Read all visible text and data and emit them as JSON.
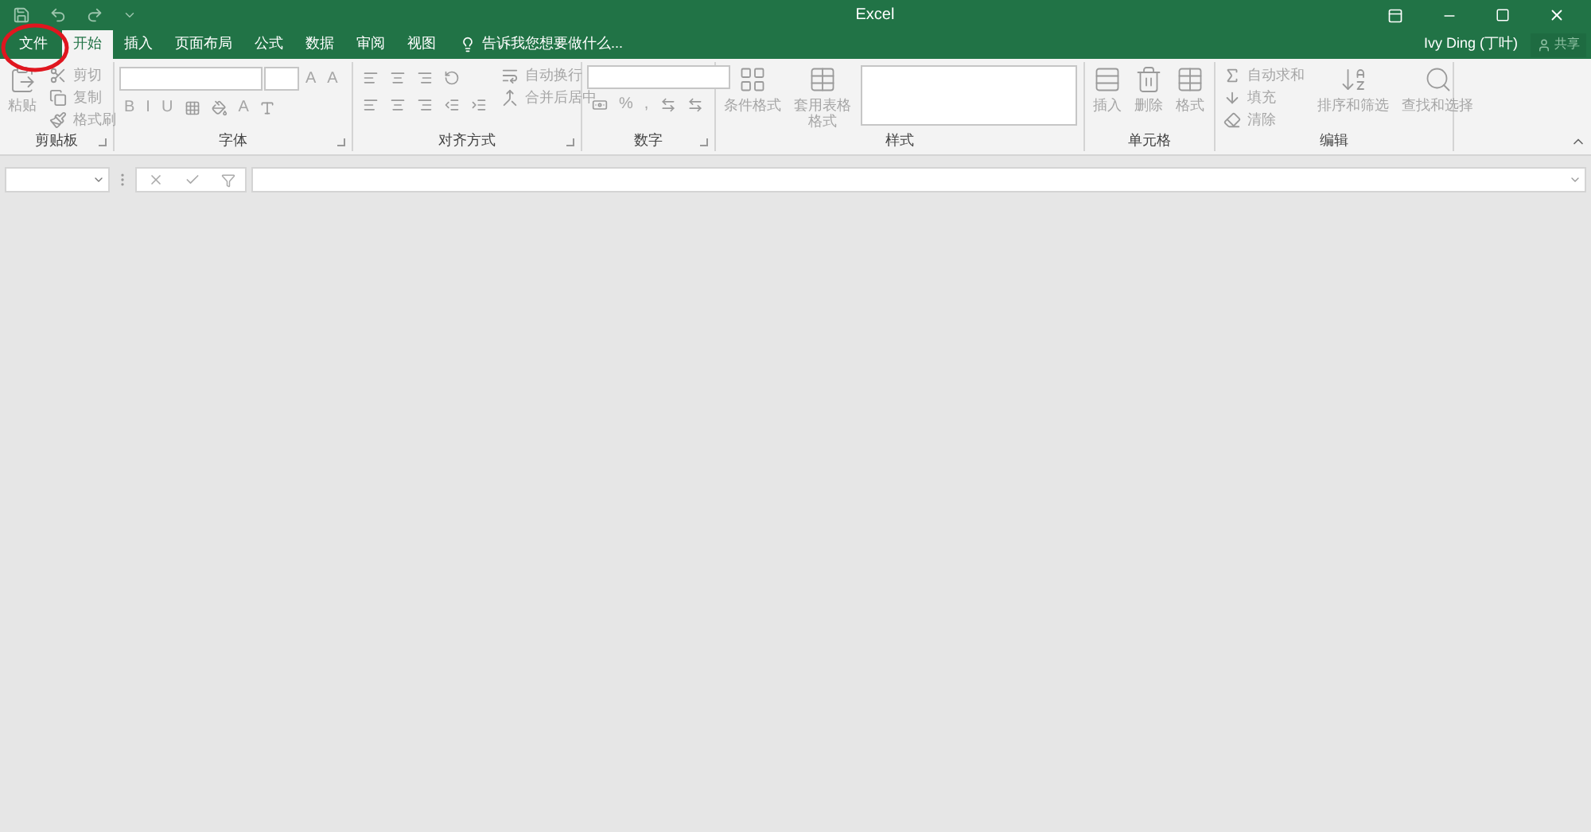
{
  "window": {
    "title": "Excel",
    "user": "Ivy Ding (丁叶)",
    "share": "共享"
  },
  "tabs": [
    {
      "label": "文件",
      "selected": false,
      "kind": "file"
    },
    {
      "label": "开始",
      "selected": true,
      "kind": "tab"
    },
    {
      "label": "插入",
      "selected": false,
      "kind": "tab"
    },
    {
      "label": "页面布局",
      "selected": false,
      "kind": "tab"
    },
    {
      "label": "公式",
      "selected": false,
      "kind": "tab"
    },
    {
      "label": "数据",
      "selected": false,
      "kind": "tab"
    },
    {
      "label": "审阅",
      "selected": false,
      "kind": "tab"
    },
    {
      "label": "视图",
      "selected": false,
      "kind": "tab"
    }
  ],
  "tell_me": "告诉我您想要做什么...",
  "ribbon": {
    "disabled": true,
    "groups": [
      {
        "label": "剪贴板",
        "launcher": true,
        "cols": [
          [
            [
              {
                "kind": "large",
                "label": "粘贴"
              }
            ]
          ],
          [
            [
              {
                "kind": "small",
                "label": "剪切"
              }
            ],
            [
              {
                "kind": "small",
                "label": "复制"
              }
            ],
            [
              {
                "kind": "small",
                "label": "格式刷"
              }
            ]
          ]
        ]
      },
      {
        "label": "字体",
        "launcher": true,
        "cols": [
          [
            [
              {
                "kind": "combo"
              },
              {
                "kind": "combo_small"
              },
              {
                "kind": "glyph",
                "label": "A"
              },
              {
                "kind": "glyph",
                "label": "A"
              }
            ],
            [
              {
                "kind": "glyph",
                "label": "B"
              },
              {
                "kind": "glyph",
                "label": "I"
              },
              {
                "kind": "glyph",
                "label": "U"
              },
              {
                "kind": "icon"
              },
              {
                "kind": "icon"
              },
              {
                "kind": "glyph",
                "label": "A"
              },
              {
                "kind": "icon"
              }
            ]
          ]
        ]
      },
      {
        "label": "对齐方式",
        "launcher": true,
        "cols": [
          [
            [
              {
                "kind": "icon"
              },
              {
                "kind": "icon"
              },
              {
                "kind": "icon"
              },
              {
                "kind": "icon"
              }
            ],
            [
              {
                "kind": "icon"
              },
              {
                "kind": "icon"
              },
              {
                "kind": "icon"
              },
              {
                "kind": "icon"
              },
              {
                "kind": "icon"
              }
            ]
          ],
          [
            [
              {
                "kind": "small",
                "label": "自动换行"
              }
            ],
            [
              {
                "kind": "small",
                "label": "合并后居中"
              }
            ]
          ]
        ]
      },
      {
        "label": "数字",
        "launcher": true,
        "cols": [
          [
            [
              {
                "kind": "combo"
              }
            ],
            [
              {
                "kind": "icon"
              },
              {
                "kind": "glyph",
                "label": "%"
              },
              {
                "kind": "glyph",
                "label": ","
              },
              {
                "kind": "icon"
              },
              {
                "kind": "icon"
              }
            ]
          ]
        ]
      },
      {
        "label": "样式",
        "launcher": false,
        "cols": [
          [
            [
              {
                "kind": "large",
                "label": "条件格式"
              }
            ]
          ],
          [
            [
              {
                "kind": "large_wrap",
                "label": "套用表格格式"
              }
            ]
          ],
          [
            [
              {
                "kind": "gallery"
              }
            ]
          ]
        ]
      },
      {
        "label": "单元格",
        "launcher": false,
        "cols": [
          [
            [
              {
                "kind": "large",
                "label": "插入"
              }
            ]
          ],
          [
            [
              {
                "kind": "large",
                "label": "删除"
              }
            ]
          ],
          [
            [
              {
                "kind": "large",
                "label": "格式"
              }
            ]
          ]
        ]
      },
      {
        "label": "编辑",
        "launcher": false,
        "cols": [
          [
            [
              {
                "kind": "small",
                "label": "自动求和"
              }
            ],
            [
              {
                "kind": "small",
                "label": "填充"
              }
            ],
            [
              {
                "kind": "small",
                "label": "清除"
              }
            ]
          ],
          [
            [
              {
                "kind": "large",
                "label": "排序和筛选"
              }
            ]
          ],
          [
            [
              {
                "kind": "large",
                "label": "查找和选择"
              }
            ]
          ]
        ]
      }
    ]
  },
  "annotation": {
    "kind": "circle"
  }
}
